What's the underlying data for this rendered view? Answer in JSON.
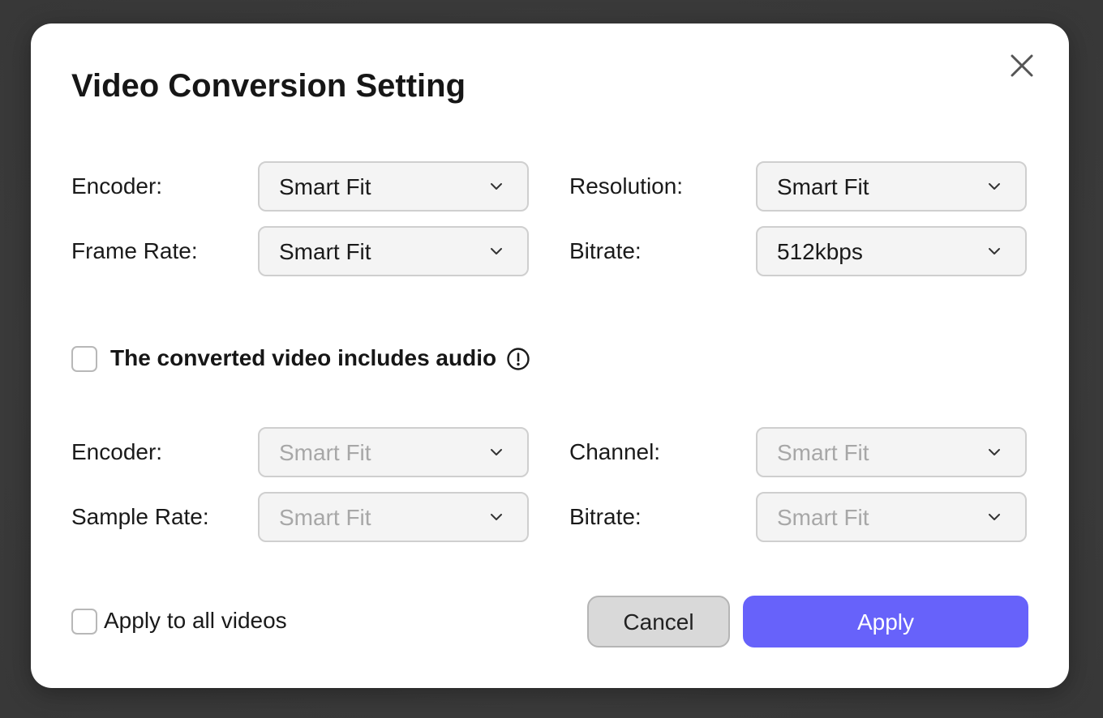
{
  "dialog": {
    "title": "Video Conversion Setting",
    "close_icon": "close-icon"
  },
  "video": {
    "encoder": {
      "label": "Encoder:",
      "value": "Smart Fit"
    },
    "resolution": {
      "label": "Resolution:",
      "value": "Smart Fit"
    },
    "frame_rate": {
      "label": "Frame Rate:",
      "value": "Smart Fit"
    },
    "bitrate": {
      "label": "Bitrate:",
      "value": "512kbps"
    }
  },
  "audio": {
    "include_label": "The converted video includes audio",
    "include_checked": false,
    "info_icon": "info-icon",
    "encoder": {
      "label": "Encoder:",
      "value": "Smart Fit",
      "disabled": true
    },
    "channel": {
      "label": "Channel:",
      "value": "Smart Fit",
      "disabled": true
    },
    "sample_rate": {
      "label": "Sample Rate:",
      "value": "Smart Fit",
      "disabled": true
    },
    "bitrate": {
      "label": "Bitrate:",
      "value": "Smart Fit",
      "disabled": true
    }
  },
  "footer": {
    "apply_all_label": "Apply to all videos",
    "apply_all_checked": false,
    "cancel_label": "Cancel",
    "apply_label": "Apply"
  },
  "colors": {
    "accent": "#6762fa",
    "disabled_text": "#a7a7a7"
  }
}
